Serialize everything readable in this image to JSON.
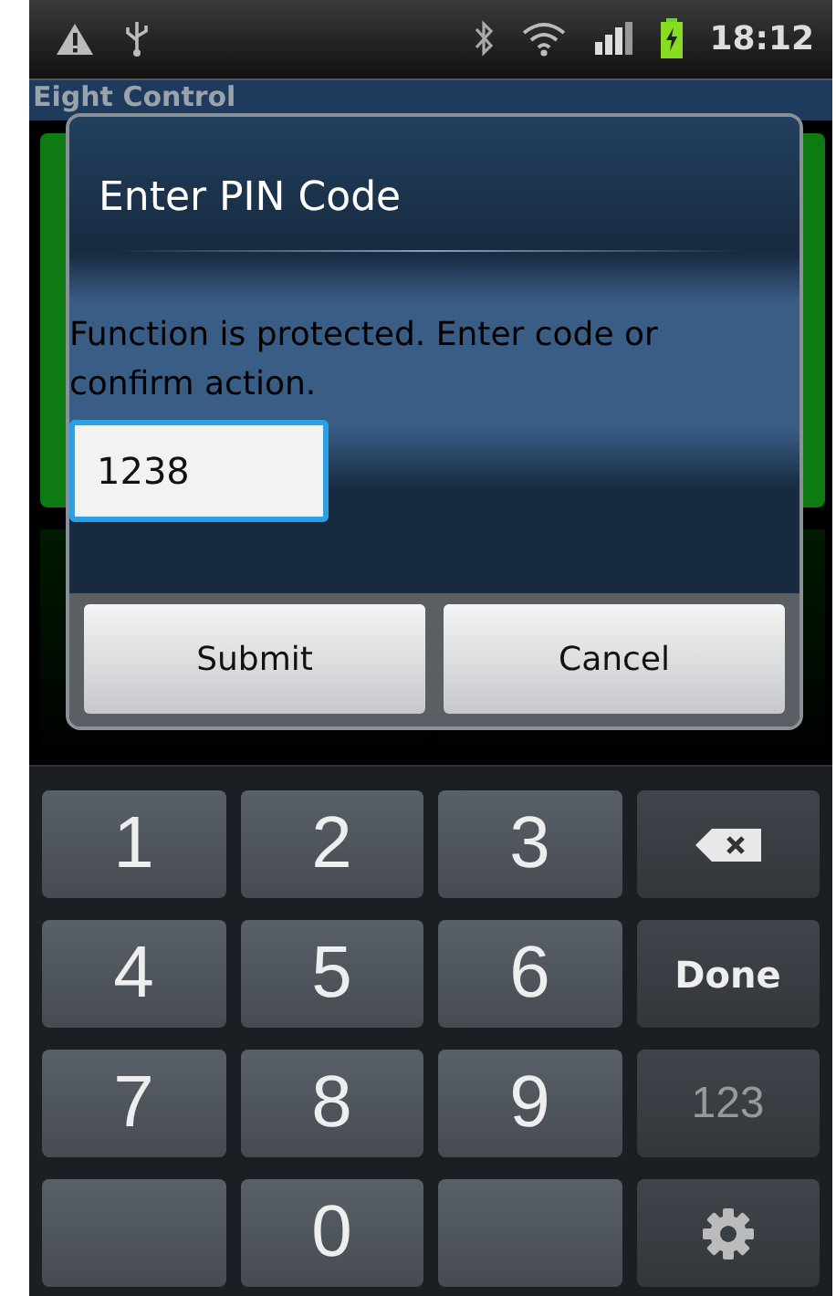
{
  "status_bar": {
    "time": "18:12"
  },
  "app": {
    "title": "Eight Control"
  },
  "dialog": {
    "title": "Enter PIN Code",
    "message": "Function is protected. Enter code or confirm action.",
    "input": {
      "value": "1238",
      "focused": true
    },
    "buttons": [
      "Submit",
      "Cancel"
    ]
  },
  "keyboard": {
    "keys": [
      {
        "kind": "digit",
        "label": "1"
      },
      {
        "kind": "digit",
        "label": "2"
      },
      {
        "kind": "digit",
        "label": "3"
      },
      {
        "kind": "backspace"
      },
      {
        "kind": "digit",
        "label": "4"
      },
      {
        "kind": "digit",
        "label": "5"
      },
      {
        "kind": "digit",
        "label": "6"
      },
      {
        "kind": "done",
        "label": "Done"
      },
      {
        "kind": "digit",
        "label": "7"
      },
      {
        "kind": "digit",
        "label": "8"
      },
      {
        "kind": "digit",
        "label": "9"
      },
      {
        "kind": "mode",
        "label": "123"
      },
      {
        "kind": "blank"
      },
      {
        "kind": "digit",
        "label": "0"
      },
      {
        "kind": "blank"
      },
      {
        "kind": "settings"
      }
    ]
  }
}
